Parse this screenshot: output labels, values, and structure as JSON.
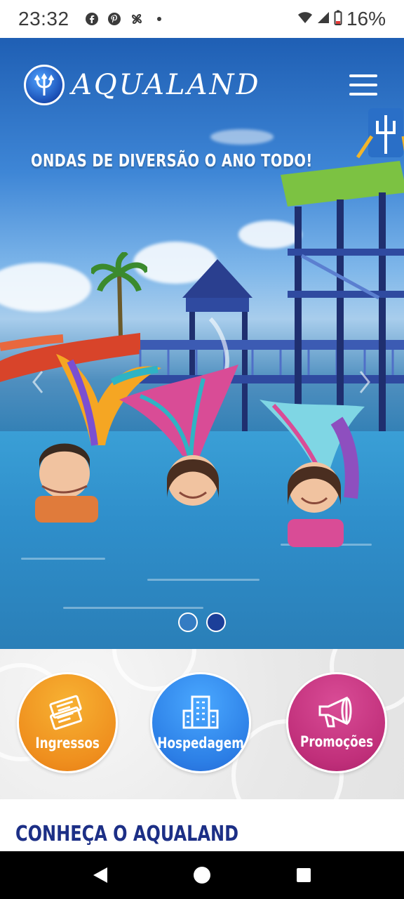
{
  "status_bar": {
    "time": "23:32",
    "battery": "16%",
    "notification_icons": [
      "facebook-icon",
      "pinterest-icon",
      "pinwheel-icon",
      "dot-icon"
    ]
  },
  "header": {
    "logo_text": "AQUALAND",
    "menu_icon": "hamburger-icon"
  },
  "hero": {
    "headline": "ONDAS DE DIVERSÃO O ANO TODO!",
    "slides_total": 2,
    "active_slide": 2
  },
  "quick_links": [
    {
      "label": "Ingressos",
      "icon": "tickets-icon",
      "color": "#ef8f1e"
    },
    {
      "label": "Hospedagem",
      "icon": "building-icon",
      "color": "#2c7fe6"
    },
    {
      "label": "Promoções",
      "icon": "megaphone-icon",
      "color": "#c02f7a"
    }
  ],
  "section": {
    "title": "CONHEÇA O AQUALAND"
  },
  "colors": {
    "brand_blue": "#1c2f86",
    "nav_bar": "#000000"
  }
}
